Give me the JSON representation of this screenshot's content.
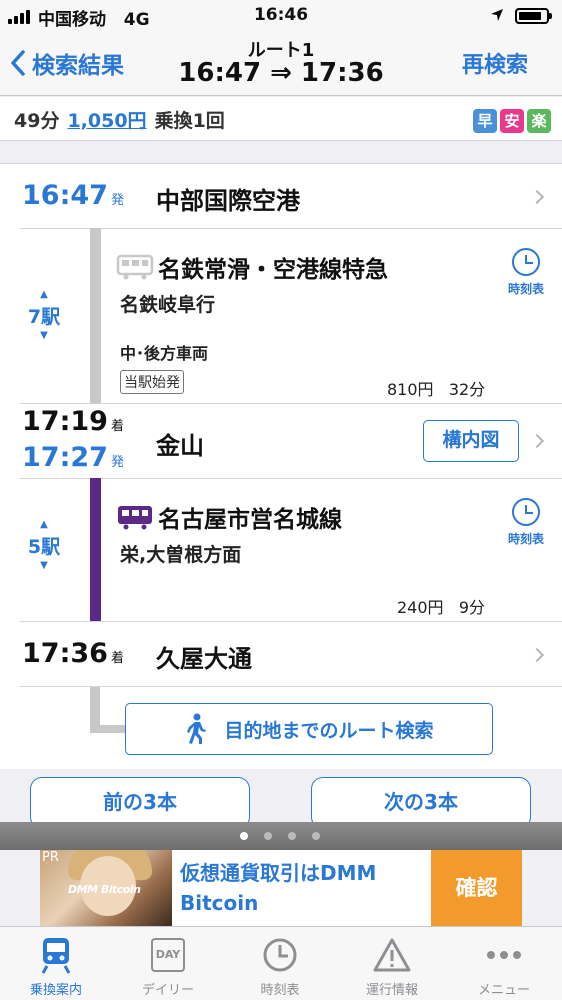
{
  "status_bar": {
    "carrier": "中国移动",
    "network": "4G",
    "time": "16:46"
  },
  "nav": {
    "back_label": "検索結果",
    "title": "ルート1",
    "time_range": "16:47 ⇒ 17:36",
    "research_label": "再検索"
  },
  "summary": {
    "duration": "49分",
    "fare": "1,050円",
    "transfers": "乗換1回",
    "badges": [
      "早",
      "安",
      "楽"
    ]
  },
  "colors": {
    "accent": "#2a78d6",
    "meitetsu": "#c8c8c8",
    "nagoya_city": "#5b2a86",
    "badge_fast": "#4a90d9",
    "badge_cheap": "#e8398a",
    "badge_easy": "#5cb85c",
    "ad_button": "#f39a2d"
  },
  "route": {
    "stop1": {
      "time": "16:47",
      "suffix": "発",
      "station": "中部国際空港"
    },
    "leg1": {
      "stops_count": "7駅",
      "line_name": "名鉄常滑・空港線特急",
      "direction": "名鉄岐阜行",
      "car_info": "中･後方車両",
      "origin_tag": "当駅始発",
      "fare": "810円",
      "duration": "32分",
      "timetable_label": "時刻表"
    },
    "stop2": {
      "arrive_time": "17:19",
      "arrive_suffix": "着",
      "depart_time": "17:27",
      "depart_suffix": "発",
      "station": "金山",
      "map_label": "構内図"
    },
    "leg2": {
      "stops_count": "5駅",
      "line_name": "名古屋市営名城線",
      "direction": "栄,大曽根方面",
      "fare": "240円",
      "duration": "9分",
      "timetable_label": "時刻表"
    },
    "stop3": {
      "time": "17:36",
      "suffix": "着",
      "station": "久屋大通"
    },
    "route_search_label": "目的地までのルート検索"
  },
  "pager": {
    "prev_label": "前の3本",
    "next_label": "次の3本",
    "active_page": 1,
    "page_count": 4
  },
  "ad": {
    "pr_label": "PR",
    "logo_text": "DMM Bitcoin",
    "copy": "仮想通貨取引はDMM Bitcoin",
    "button_label": "確認"
  },
  "tabs": [
    {
      "label": "乗換案内",
      "icon": "train-icon",
      "active": true
    },
    {
      "label": "デイリー",
      "icon": "day-calendar-icon",
      "active": false
    },
    {
      "label": "時刻表",
      "icon": "clock-icon",
      "active": false
    },
    {
      "label": "運行情報",
      "icon": "warning-icon",
      "active": false
    },
    {
      "label": "メニュー",
      "icon": "more-icon",
      "active": false
    }
  ],
  "day_icon_text": "DAY"
}
